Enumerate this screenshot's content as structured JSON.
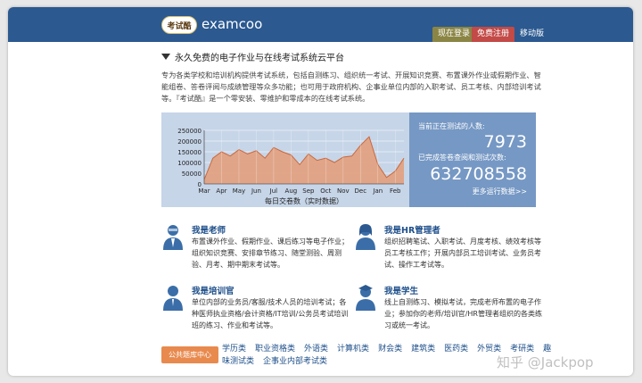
{
  "header": {
    "logo_text": "考试酷",
    "brand": "examcoo",
    "login": "现在登录",
    "register": "免费注册",
    "mobile": "移动版"
  },
  "headline": "永久免费的电子作业与在线考试系统云平台",
  "intro": "专为各类学校和培训机构提供考试系统，包括自测练习、组织统一考试、开展知识竞赛、布置课外作业或假期作业、智能组卷、答卷评阅与成绩管理等众多功能；也可用于政府机构、企事业单位内部的入职考试、员工考核、内部培训考试等。『考试酷』是一个零安装、零维护和零成本的在线考试系统。",
  "stats": {
    "online_label": "当前正在测试的人数:",
    "online_value": "7973",
    "done_label": "已完成答卷查阅和测试次数:",
    "done_value": "632708558",
    "more": "更多运行数据>>"
  },
  "chart_data": {
    "type": "area",
    "title": "",
    "xlabel": "每日交卷数（实时数据）",
    "ylabel": "",
    "ylim": [
      0,
      250000
    ],
    "yticks": [
      0,
      50000,
      100000,
      150000,
      200000,
      250000
    ],
    "xticks": [
      "Mar",
      "Apr",
      "May",
      "Jun",
      "Jul",
      "Aug",
      "Sep",
      "Oct",
      "Nov",
      "Dec",
      "Jan",
      "Feb"
    ],
    "grid": true,
    "colors": {
      "fill": "#e2a283",
      "line": "#c9683e",
      "bg": "#c6d5e8"
    },
    "x": [
      0,
      0.5,
      1,
      1.5,
      2,
      2.5,
      3,
      3.5,
      4,
      4.5,
      5,
      5.5,
      6,
      6.5,
      7,
      7.5,
      8,
      8.5,
      9,
      9.5,
      10,
      10.5,
      11,
      11.5
    ],
    "values": [
      20000,
      120000,
      150000,
      130000,
      160000,
      140000,
      155000,
      120000,
      170000,
      150000,
      135000,
      90000,
      140000,
      110000,
      120000,
      100000,
      125000,
      130000,
      180000,
      220000,
      90000,
      30000,
      60000,
      120000
    ]
  },
  "roles": [
    {
      "title": "我是老师",
      "desc": "布置课外作业、假期作业、课后练习等电子作业；组织知识竞赛、安排章节练习、随堂测验、周测验、月考、期中期末考试等。",
      "icon": "teacher-icon"
    },
    {
      "title": "我是HR管理者",
      "desc": "组织招聘笔试、入职考试、月度考核、绩效考核等员工考核工作；开展内部员工培训考试、业务员考试、操作工考试等。",
      "icon": "hr-manager-icon"
    },
    {
      "title": "我是培训官",
      "desc": "单位内部的业务员/客服/技术人员的培训考试；各种医师执业资格/会计资格/IT培训/公务员考试培训班的练习、作业和考试等。",
      "icon": "trainer-icon"
    },
    {
      "title": "我是学生",
      "desc": "线上自测练习、模拟考试，完成老师布置的电子作业；参加你的老师/培训官/HR管理者组织的各类练习或统一考试。",
      "icon": "student-icon"
    }
  ],
  "footer": {
    "pill": "公共题库中心",
    "links": [
      "学历类",
      "职业资格类",
      "外语类",
      "计算机类",
      "财会类",
      "建筑类",
      "医药类",
      "外贸类",
      "考研类",
      "趣味测试类",
      "企事业内部考试类"
    ]
  },
  "watermark": "知乎 @Jackpop"
}
